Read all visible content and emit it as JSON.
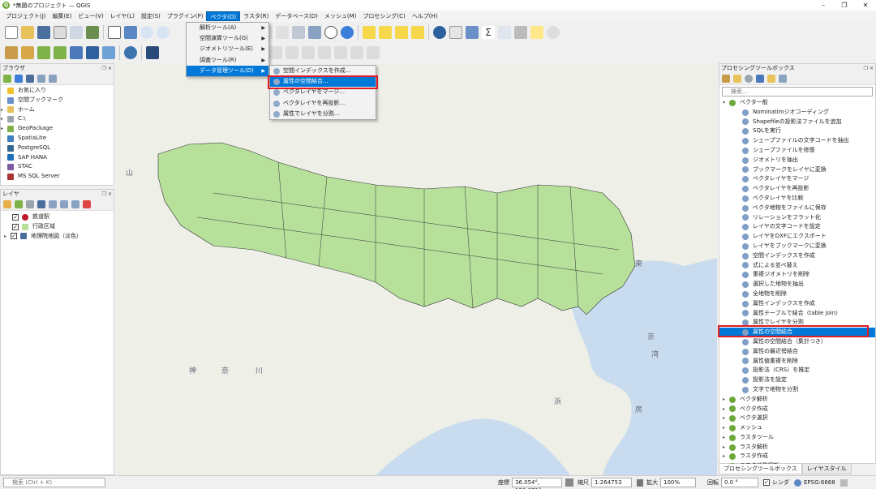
{
  "window": {
    "title": "*無題のプロジェクト — QGIS",
    "app_icon": "qgis-logo",
    "controls": [
      "–",
      "❐",
      "✕"
    ]
  },
  "menubar": [
    {
      "label": "プロジェクト(J)"
    },
    {
      "label": "編集(E)"
    },
    {
      "label": "ビュー(V)"
    },
    {
      "label": "レイヤ(L)"
    },
    {
      "label": "設定(S)"
    },
    {
      "label": "プラグイン(P)"
    },
    {
      "label": "ベクタ(O)",
      "active": true
    },
    {
      "label": "ラスタ(R)"
    },
    {
      "label": "データベース(D)"
    },
    {
      "label": "メッシュ(M)"
    },
    {
      "label": "プロセシング(C)"
    },
    {
      "label": "ヘルプ(H)"
    }
  ],
  "vector_menu": {
    "items": [
      {
        "label": "解析ツール(A)",
        "submenu": true
      },
      {
        "label": "空間演算ツール(G)",
        "submenu": true
      },
      {
        "label": "ジオメトリツール(E)",
        "submenu": true
      },
      {
        "label": "調査ツール(R)",
        "submenu": true
      },
      {
        "label": "データ管理ツール(D)",
        "submenu": true,
        "highlight": true
      }
    ]
  },
  "data_mgmt_submenu": {
    "items": [
      {
        "label": "空間インデックスを作成..."
      },
      {
        "label": "属性の空間結合...",
        "highlight": true
      },
      {
        "label": "ベクタレイヤをマージ..."
      },
      {
        "label": "ベクタレイヤを再投影..."
      },
      {
        "label": "属性でレイヤを分割..."
      }
    ]
  },
  "browser_panel": {
    "title": "ブラウザ",
    "items": [
      {
        "label": "お気に入り",
        "icon": "star-icon",
        "color": "#f2c12e",
        "arrow": ""
      },
      {
        "label": "空間ブックマーク",
        "icon": "bookmark-icon",
        "color": "#6a8fc9",
        "arrow": ""
      },
      {
        "label": "ホーム",
        "icon": "folder-icon",
        "color": "#e8c25a",
        "arrow": "▸"
      },
      {
        "label": "C:\\",
        "icon": "drive-icon",
        "color": "#9aa4ad",
        "arrow": "▸"
      },
      {
        "label": "GeoPackage",
        "icon": "geopackage-icon",
        "color": "#7fb34a",
        "arrow": "▸"
      },
      {
        "label": "SpatiaLite",
        "icon": "spatialite-icon",
        "color": "#3d7fbf",
        "arrow": ""
      },
      {
        "label": "PostgreSQL",
        "icon": "postgresql-icon",
        "color": "#336791",
        "arrow": ""
      },
      {
        "label": "SAP HANA",
        "icon": "hana-icon",
        "color": "#1d6fb8",
        "arrow": ""
      },
      {
        "label": "STAC",
        "icon": "stac-icon",
        "color": "#7d5ba6",
        "arrow": ""
      },
      {
        "label": "MS SQL Server",
        "icon": "mssql-icon",
        "color": "#a33",
        "arrow": ""
      }
    ]
  },
  "layers_panel": {
    "title": "レイヤ",
    "layers": [
      {
        "label": "鉄道駅",
        "icon": "point-layer-icon",
        "color": "#c0182c",
        "checked": true,
        "indent": 1
      },
      {
        "label": "行政区域",
        "icon": "polygon-layer-icon",
        "color": "#b7e09b",
        "checked": true,
        "indent": 1
      },
      {
        "label": "地理院地図（淡色）",
        "icon": "raster-layer-icon",
        "color": "#4a6f9e",
        "checked": true,
        "indent": 0
      }
    ]
  },
  "processing_panel": {
    "title": "プロセシングツールボックス",
    "search_placeholder": "検索...",
    "group": "ベクタ一般",
    "tools": [
      "Nominatimジオコーディング",
      "Shapefileの投影法ファイルを追加",
      "SQLを実行",
      "シェープファイルの文字コードを抽出",
      "シェープファイルを修復",
      "ジオメトリを抽出",
      "ブックマークをレイヤに変換",
      "ベクタレイヤをマージ",
      "ベクタレイヤを再投影",
      "ベクタレイヤを比較",
      "ベクタ地物をファイルに保存",
      "リレーションをフラット化",
      "レイヤの文字コードを設定",
      "レイヤをDXFにエクスポート",
      "レイヤをブックマークに変換",
      "空間インデックスを作成",
      "式による並べ替え",
      "重複ジオメトリを削除",
      "選択した地物を抽出",
      "全地物を削除",
      "属性インデックスを作成",
      "属性テーブルで結合（table join）",
      "属性でレイヤを分割",
      "属性の空間結合",
      "属性の空間結合（集計つき）",
      "属性の最近傍結合",
      "属性値重複を削除",
      "投影法（CRS）を推定",
      "投影法を設定",
      "文字で地物を分割"
    ],
    "highlighted_tool": "属性の空間結合",
    "other_groups": [
      "ベクタ解析",
      "ベクタ作成",
      "ベクタ選択",
      "メッシュ",
      "ラスタツール",
      "ラスタ解析",
      "ラスタ作成",
      "ラスタ地形解析"
    ],
    "tabs": [
      "プロセシングツールボックス",
      "レイヤスタイル"
    ]
  },
  "map": {
    "labels": [
      "山",
      "神",
      "奈",
      "川",
      "東",
      "京",
      "湾",
      "浜",
      "房"
    ],
    "point_color": "#c0182c",
    "polygon_color": "#b7e09b",
    "water_color": "#c9dcef",
    "land_color": "#eef0e8"
  },
  "statusbar": {
    "search_placeholder": "検索 (Ctrl + K)",
    "coordinate_label": "座標",
    "coordinate": "36.054°, 139.071°",
    "scale_label": "縮尺",
    "scale": "1:264753",
    "magnifier_label": "拡大",
    "magnifier": "100%",
    "rotation_label": "回転",
    "rotation": "0.0 °",
    "render_label": "レンダ",
    "crs": "EPSG:6668"
  }
}
